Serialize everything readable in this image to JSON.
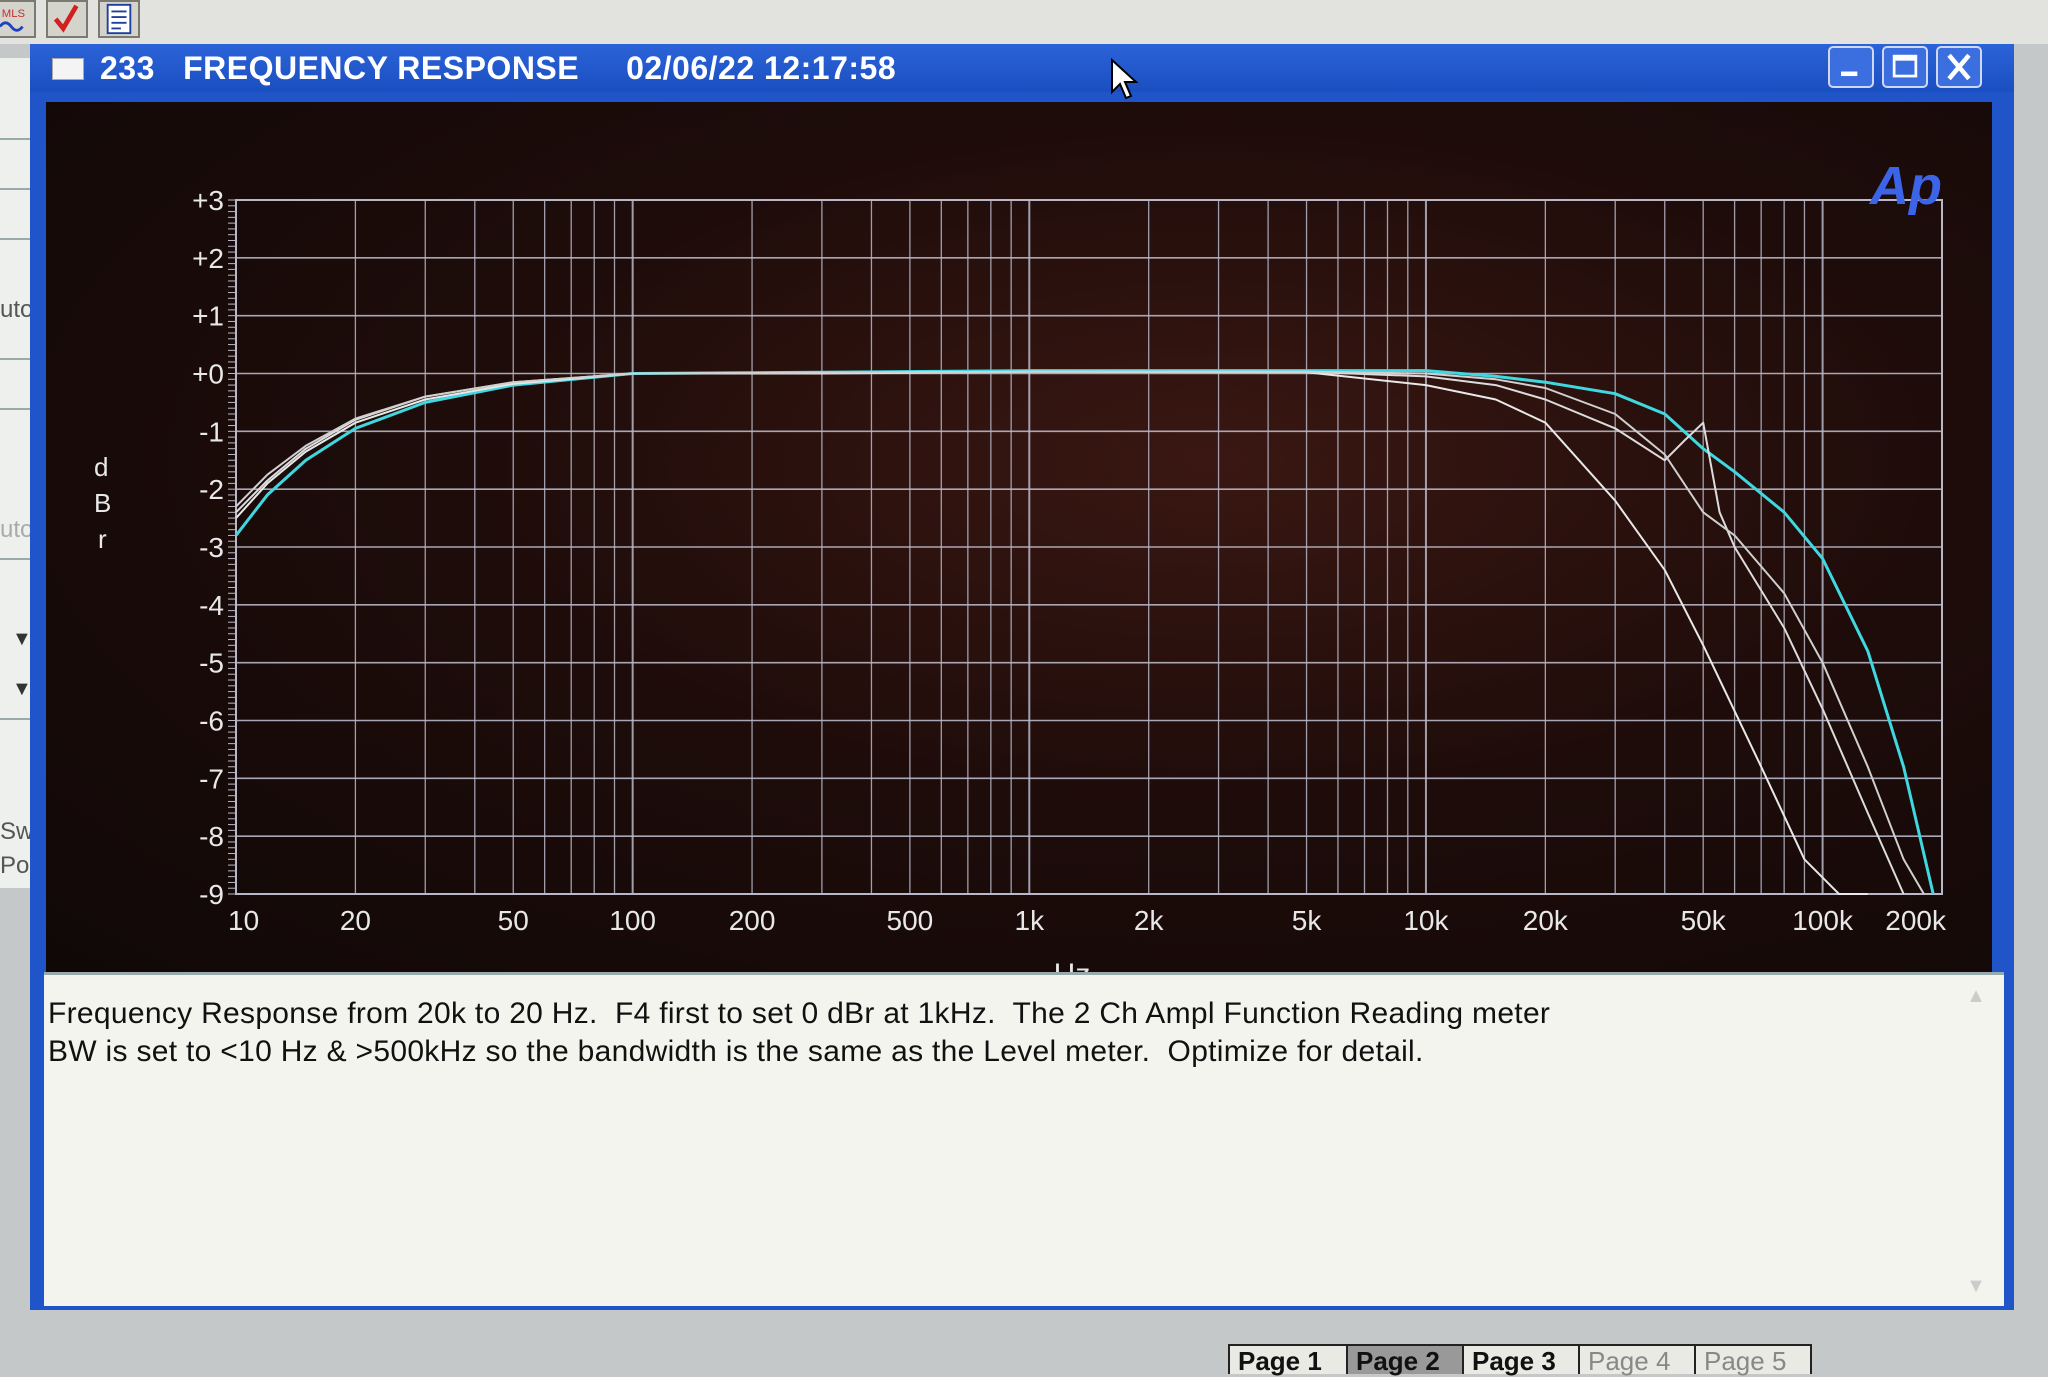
{
  "window": {
    "number": "233",
    "title": "FREQUENCY RESPONSE",
    "timestamp": "02/06/22 12:17:58"
  },
  "toolbar": {
    "icons": [
      "mls-icon",
      "check-icon",
      "list-icon"
    ]
  },
  "left_panel": {
    "fragments": [
      "uto",
      "uto",
      "Swe",
      "Poin"
    ]
  },
  "chart": {
    "logo": "Ap",
    "ylabel": [
      "d",
      "B",
      "r"
    ],
    "xlabel": "Hz",
    "y_ticks": [
      "+3",
      "+2",
      "+1",
      "+0",
      "-1",
      "-2",
      "-3",
      "-4",
      "-5",
      "-6",
      "-7",
      "-8",
      "-9"
    ],
    "x_ticks": [
      "10",
      "20",
      "50",
      "100",
      "200",
      "500",
      "1k",
      "2k",
      "5k",
      "10k",
      "20k",
      "50k",
      "100k",
      "200k"
    ]
  },
  "chart_data": {
    "type": "line",
    "xscale": "log",
    "xlim": [
      10,
      200000
    ],
    "ylim": [
      -9,
      3
    ],
    "xlabel": "Hz",
    "ylabel": "dBr",
    "grid": true,
    "colors": {
      "cyan": "#40d8e0",
      "white": "#e8e8e8",
      "grid": "#b8b8c8"
    },
    "series": [
      {
        "color": "#40d8e0",
        "x": [
          10,
          12,
          15,
          20,
          30,
          50,
          100,
          300,
          1000,
          5000,
          10000,
          15000,
          20000,
          30000,
          40000,
          50000,
          60000,
          80000,
          100000,
          130000,
          160000,
          190000
        ],
        "y": [
          -2.8,
          -2.1,
          -1.5,
          -0.95,
          -0.5,
          -0.2,
          0.0,
          0.02,
          0.05,
          0.05,
          0.05,
          -0.05,
          -0.15,
          -0.35,
          -0.7,
          -1.3,
          -1.7,
          -2.4,
          -3.2,
          -4.8,
          -6.8,
          -9.0
        ]
      },
      {
        "color": "#e8e8e8",
        "x": [
          10,
          12,
          15,
          20,
          30,
          50,
          100,
          300,
          1000,
          5000,
          10000,
          15000,
          20000,
          30000,
          40000,
          50000,
          70000,
          90000,
          110000,
          130000
        ],
        "y": [
          -2.5,
          -1.9,
          -1.35,
          -0.85,
          -0.45,
          -0.18,
          0.0,
          0.0,
          0.03,
          0.02,
          -0.2,
          -0.45,
          -0.85,
          -2.2,
          -3.4,
          -4.7,
          -6.8,
          -8.4,
          -9.0,
          -9.0
        ]
      },
      {
        "color": "#dcdcdc",
        "x": [
          10,
          12,
          15,
          20,
          30,
          50,
          100,
          1000,
          5000,
          10000,
          15000,
          20000,
          30000,
          40000,
          45000,
          50000,
          55000,
          60000,
          80000,
          100000,
          130000,
          160000
        ],
        "y": [
          -2.4,
          -1.85,
          -1.3,
          -0.8,
          -0.4,
          -0.15,
          0.0,
          0.03,
          0.03,
          -0.05,
          -0.2,
          -0.45,
          -0.95,
          -1.5,
          -1.15,
          -0.85,
          -2.4,
          -3.0,
          -4.4,
          -5.8,
          -7.6,
          -9.0
        ]
      },
      {
        "color": "#d0d0d0",
        "x": [
          10,
          12,
          15,
          20,
          30,
          50,
          100,
          1000,
          5000,
          10000,
          15000,
          20000,
          30000,
          40000,
          50000,
          60000,
          80000,
          100000,
          130000,
          160000,
          180000
        ],
        "y": [
          -2.3,
          -1.75,
          -1.25,
          -0.78,
          -0.4,
          -0.15,
          0.0,
          0.03,
          0.03,
          0.0,
          -0.1,
          -0.25,
          -0.7,
          -1.4,
          -2.4,
          -2.8,
          -3.8,
          -5.0,
          -6.8,
          -8.4,
          -9.0
        ]
      }
    ]
  },
  "notes": {
    "line1": "Frequency Response from 20k to 20 Hz.  F4 first to set 0 dBr at 1kHz.  The 2 Ch Ampl Function Reading meter",
    "line2": "BW is set to <10 Hz & >500kHz so the bandwidth is the same as the Level meter.  Optimize for detail."
  },
  "page_tabs": [
    "Page 1",
    "Page 2",
    "Page 3",
    "Page 4",
    "Page 5"
  ]
}
